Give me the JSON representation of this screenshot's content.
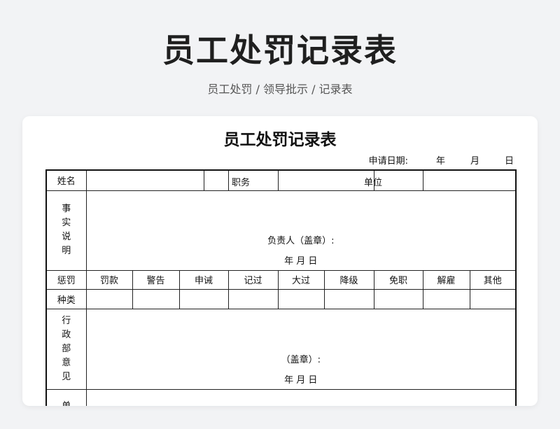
{
  "header": {
    "title": "员工处罚记录表",
    "breadcrumb": "员工处罚 / 领导批示 / 记录表"
  },
  "form": {
    "title": "员工处罚记录表",
    "date_label": "申请日期:",
    "date_year": "年",
    "date_month": "月",
    "date_day": "日",
    "name_label": "姓名",
    "position_label": "职务",
    "unit_label": "单位",
    "fact_label": [
      "事",
      "实",
      "说",
      "明"
    ],
    "responsible_label": "负责人（盖章）:",
    "sign_date": "年   月   日",
    "punish_label_1": "惩罚",
    "punish_label_2": "种类",
    "punish_types": [
      "罚款",
      "警告",
      "申诫",
      "记过",
      "大过",
      "降级",
      "免职",
      "解雇",
      "其他"
    ],
    "admin_label": [
      "行",
      "政",
      "部",
      "意",
      "见"
    ],
    "admin_seal": "（盖章）:",
    "admin_date": "年   月   日",
    "unit_opinion_label": [
      "单"
    ]
  }
}
